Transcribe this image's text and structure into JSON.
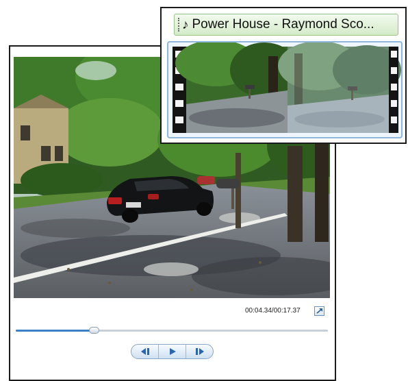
{
  "preview": {
    "time_readout": "00:04.34/00:17.37",
    "seek_progress": 0.25,
    "controls": {
      "prev_frame_icon": "previous-frame-icon",
      "play_icon": "play-icon",
      "next_frame_icon": "next-frame-icon",
      "expand_icon": "expand-arrow-icon"
    }
  },
  "storyboard": {
    "audio_icon": "music-note-icon",
    "audio_title": "Power House - Raymond Sco..."
  },
  "colors": {
    "accent": "#3c7fc9",
    "audio_strip": "#d4ebc9",
    "clip_border": "#8fb7de"
  }
}
